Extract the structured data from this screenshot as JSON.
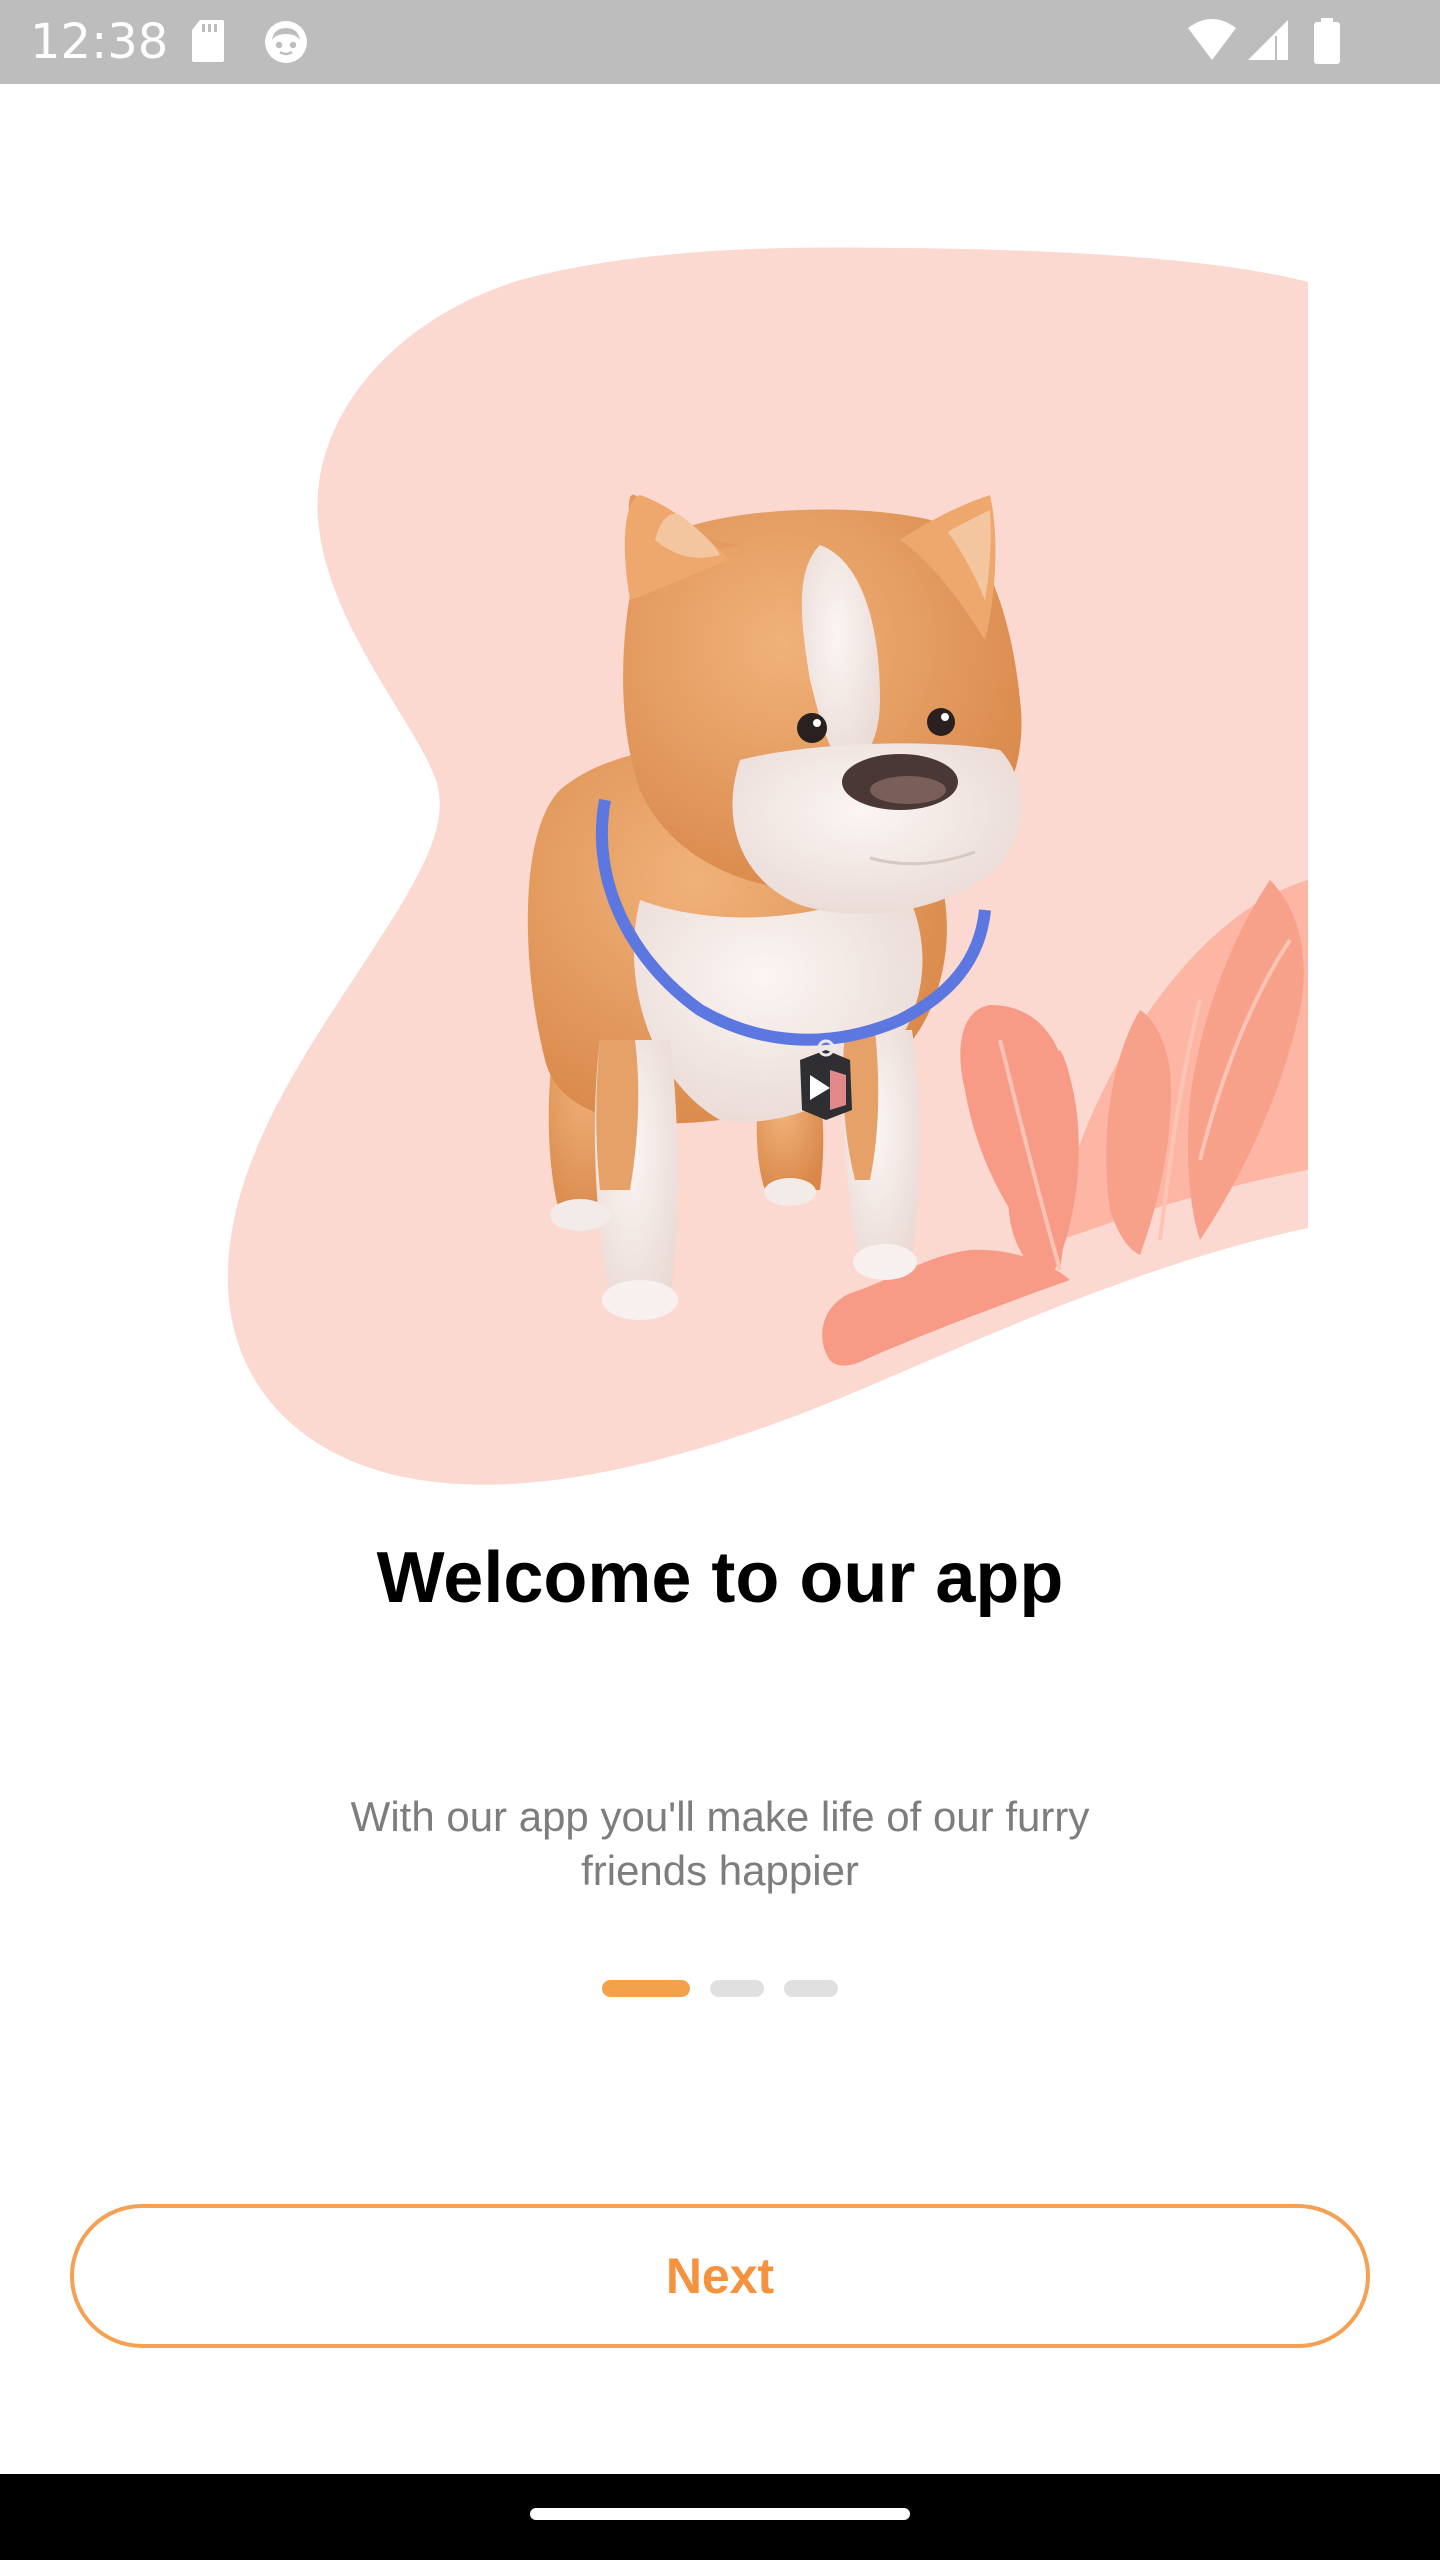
{
  "status_bar": {
    "time": "12:38",
    "left_icons": [
      "sd-card-icon",
      "notification-face-icon"
    ],
    "right_icons": [
      "wifi-icon",
      "signal-icon",
      "battery-icon"
    ]
  },
  "hero": {
    "image": "corgi-dog-illustration",
    "colors": {
      "blob": "#fbd9d1",
      "leaves": "#f7a08a",
      "leaves_light": "#fcb6a3"
    }
  },
  "onboarding": {
    "title": "Welcome to our app",
    "subtitle": "With our app you'll make life of our furry friends happier",
    "pager": {
      "total": 3,
      "active_index": 0
    }
  },
  "actions": {
    "next_label": "Next"
  },
  "colors": {
    "accent": "#f5923d",
    "pager_active": "#f2a24b",
    "pager_inactive": "#e0e0e0",
    "title": "#000000",
    "subtitle": "#7d7d7d"
  }
}
